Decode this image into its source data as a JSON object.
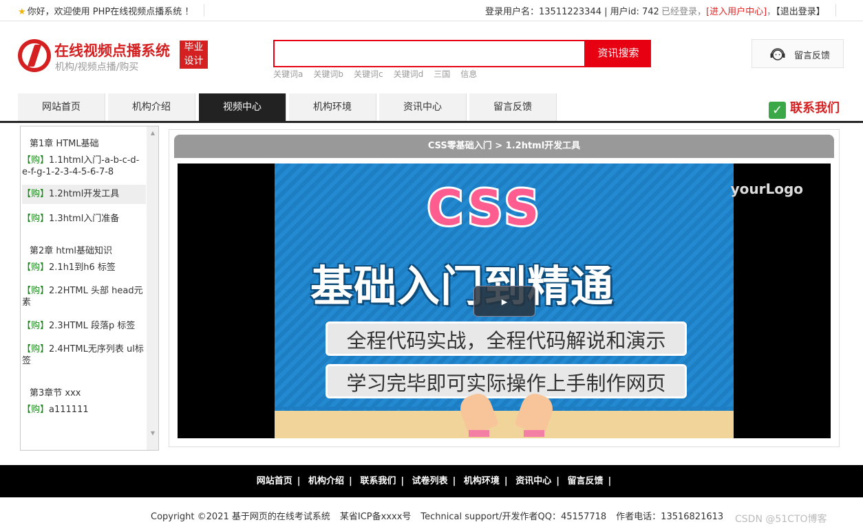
{
  "topbar": {
    "welcome": "你好，欢迎使用 PHP在线视频点播系统 ！",
    "user_info": "登录用户名：13511223344 | 用户id: 742",
    "login_state": "已经登录，",
    "enter_user_center": "[进入用户中心]",
    "comma": "，",
    "logout": "【退出登录】"
  },
  "header": {
    "site_title": "在线视频点播系统",
    "site_subtitle": "机构/视频点播/购买",
    "badge_line1": "毕业",
    "badge_line2": "设计",
    "search_placeholder": "",
    "search_button": "资讯搜索",
    "keywords": [
      "关键词a",
      "关键词b",
      "关键词c",
      "关键词d",
      "三国",
      "信息"
    ],
    "feedback": "留言反馈"
  },
  "nav": {
    "items": [
      "网站首页",
      "机构介绍",
      "视频中心",
      "机构环境",
      "资讯中心",
      "留言反馈"
    ],
    "active_index": 2,
    "contact": "联系我们"
  },
  "sidebar": {
    "chapters": [
      {
        "title": "第1章 HTML基础",
        "lessons": [
          {
            "tag": "【购】",
            "name": "1.1html入门-a-b-c-d-e-f-g-1-2-3-4-5-6-7-8"
          },
          {
            "tag": "【购】",
            "name": "1.2html开发工具"
          },
          {
            "tag": "【购】",
            "name": "1.3html入门准备"
          }
        ]
      },
      {
        "title": "第2章 html基础知识",
        "lessons": [
          {
            "tag": "【购】",
            "name": "2.1h1到h6 标签"
          },
          {
            "tag": "【购】",
            "name": "2.2HTML 头部 head元素"
          },
          {
            "tag": "【购】",
            "name": "2.3HTML 段落p 标签"
          },
          {
            "tag": "【购】",
            "name": "2.4HTML无序列表 ul标签"
          }
        ]
      },
      {
        "title": "第3章节 xxx",
        "lessons": [
          {
            "tag": "【购】",
            "name": "a111111"
          }
        ]
      }
    ]
  },
  "video": {
    "breadcrumb": "CSS零基础入门 > 1.2html开发工具",
    "poster_title": "CSS",
    "poster_headline": "基础入门到精通",
    "poster_line1": "全程代码实战，全程代码解说和演示",
    "poster_line2": "学习完毕即可实际操作上手制作网页",
    "watermark_logo": "yourLogo",
    "play_symbol": "▶"
  },
  "footer": {
    "links": [
      "网站首页",
      "机构介绍",
      "联系我们",
      "试卷列表",
      "机构环境",
      "资讯中心",
      "留言反馈"
    ],
    "copyright": "Copyright ©2021 基于网页的在线考试系统",
    "icp": "某省ICP备xxxx号",
    "support": "Technical support/开发作者QQ：45157718",
    "phone": "作者电话：13516821613"
  },
  "watermark": "CSDN @51CTO博客",
  "colors": {
    "brand_red": "#d42020",
    "search_red": "#e60012",
    "nav_active": "#222222",
    "buy_green": "#1a8a1a"
  }
}
